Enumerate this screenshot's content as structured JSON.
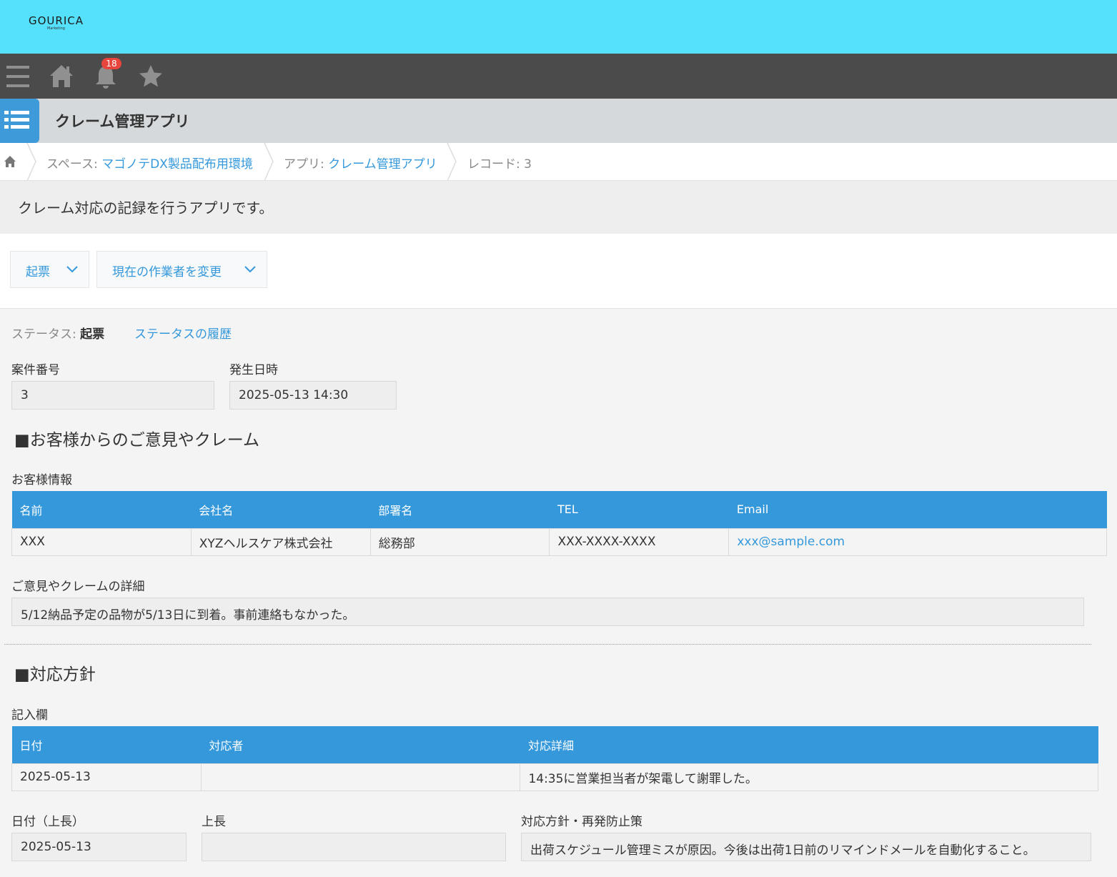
{
  "brand": {
    "logo": "GOURICA",
    "logo_sub": "Marketing"
  },
  "nav": {
    "notification_count": "18"
  },
  "app": {
    "title": "クレーム管理アプリ"
  },
  "breadcrumb": {
    "space_prefix": "スペース: ",
    "space_name": "マゴノテDX製品配布用環境",
    "app_prefix": "アプリ: ",
    "app_name": "クレーム管理アプリ",
    "record": "レコード: 3"
  },
  "description": "クレーム対応の記録を行うアプリです。",
  "actions": {
    "action_label": "起票",
    "assignee_label": "現在の作業者を変更"
  },
  "status": {
    "prefix": "ステータス: ",
    "value": "起票",
    "history_link": "ステータスの履歴"
  },
  "fields": {
    "case_number_label": "案件番号",
    "case_number": "3",
    "occurred_label": "発生日時",
    "occurred": "2025-05-13 14:30"
  },
  "section1": {
    "title": "■お客様からのご意見やクレーム"
  },
  "customer": {
    "label": "お客様情報",
    "headers": [
      "名前",
      "会社名",
      "部署名",
      "TEL",
      "Email"
    ],
    "row": [
      "XXX",
      "XYZヘルスケア株式会社",
      "総務部",
      "XXX-XXXX-XXXX",
      "xxx@sample.com"
    ]
  },
  "detail": {
    "label": "ご意見やクレームの詳細",
    "value": "5/12納品予定の品物が5/13日に到着。事前連絡もなかった。"
  },
  "section2": {
    "title": "■対応方針"
  },
  "entries": {
    "label": "記入欄",
    "headers": [
      "日付",
      "対応者",
      "対応詳細"
    ],
    "row": [
      "2025-05-13",
      "",
      "14:35に営業担当者が架電して謝罪した。"
    ]
  },
  "supervisor": {
    "date_label": "日付（上長）",
    "date": "2025-05-13",
    "name_label": "上長",
    "name": "",
    "policy_label": "対応方針・再発防止策",
    "policy": "出荷スケジュール管理ミスが原因。今後は出荷1日前のリマインドメールを自動化すること。"
  }
}
